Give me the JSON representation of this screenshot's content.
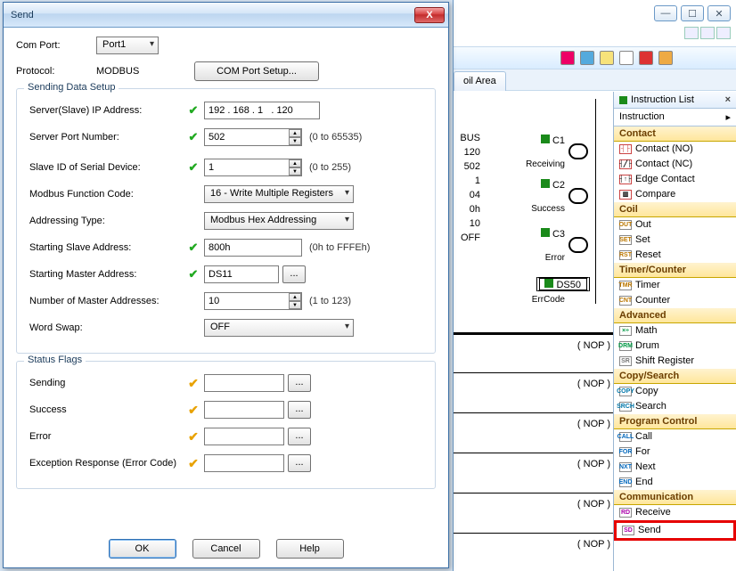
{
  "dialog": {
    "title": "Send",
    "comport_label": "Com Port:",
    "comport_value": "Port1",
    "protocol_label": "Protocol:",
    "protocol_value": "MODBUS",
    "setup_btn": "COM Port Setup...",
    "group1_title": "Sending Data Setup",
    "ip_label": "Server(Slave) IP Address:",
    "ip_value": "192 . 168 . 1   . 120",
    "port_label": "Server Port Number:",
    "port_value": "502",
    "port_range": "(0 to 65535)",
    "slaveid_label": "Slave ID of Serial Device:",
    "slaveid_value": "1",
    "slaveid_range": "(0 to 255)",
    "func_label": "Modbus Function Code:",
    "func_value": "16 - Write Multiple Registers",
    "addr_type_label": "Addressing Type:",
    "addr_type_value": "Modbus Hex Addressing",
    "slave_addr_label": "Starting Slave Address:",
    "slave_addr_value": "800h",
    "slave_addr_range": "(0h to FFFEh)",
    "master_addr_label": "Starting Master Address:",
    "master_addr_value": "DS11",
    "num_addr_label": "Number of Master Addresses:",
    "num_addr_value": "10",
    "num_addr_range": "(1 to 123)",
    "swap_label": "Word Swap:",
    "swap_value": "OFF",
    "group2_title": "Status Flags",
    "sending_label": "Sending",
    "success_label": "Success",
    "error_label": "Error",
    "exc_label": "Exception Response (Error Code)",
    "ok_btn": "OK",
    "cancel_btn": "Cancel",
    "help_btn": "Help"
  },
  "bg": {
    "tab": "oil Area",
    "bus": "BUS",
    "v120": "120",
    "v502": "502",
    "v1": "1",
    "v04": "04",
    "v0h": "0h",
    "v10": "10",
    "voff": "OFF",
    "c1": "C1",
    "c2": "C2",
    "c3": "C3",
    "recv": "Receiving",
    "succ": "Success",
    "err": "Error",
    "ds50": "DS50",
    "errcode": "ErrCode",
    "nop": "( NOP )"
  },
  "instr": {
    "panel_title": "Instruction List",
    "subtitle": "Instruction",
    "cat_contact": "Contact",
    "contact_no": "Contact (NO)",
    "contact_nc": "Contact (NC)",
    "edge_contact": "Edge Contact",
    "compare": "Compare",
    "cat_coil": "Coil",
    "out": "Out",
    "set": "Set",
    "reset": "Reset",
    "cat_timer": "Timer/Counter",
    "timer": "Timer",
    "counter": "Counter",
    "cat_adv": "Advanced",
    "math": "Math",
    "drum": "Drum",
    "shift": "Shift Register",
    "cat_copy": "Copy/Search",
    "copy": "Copy",
    "search": "Search",
    "cat_prog": "Program Control",
    "call": "Call",
    "for": "For",
    "next": "Next",
    "end": "End",
    "cat_comm": "Communication",
    "receive": "Receive",
    "send": "Send"
  }
}
